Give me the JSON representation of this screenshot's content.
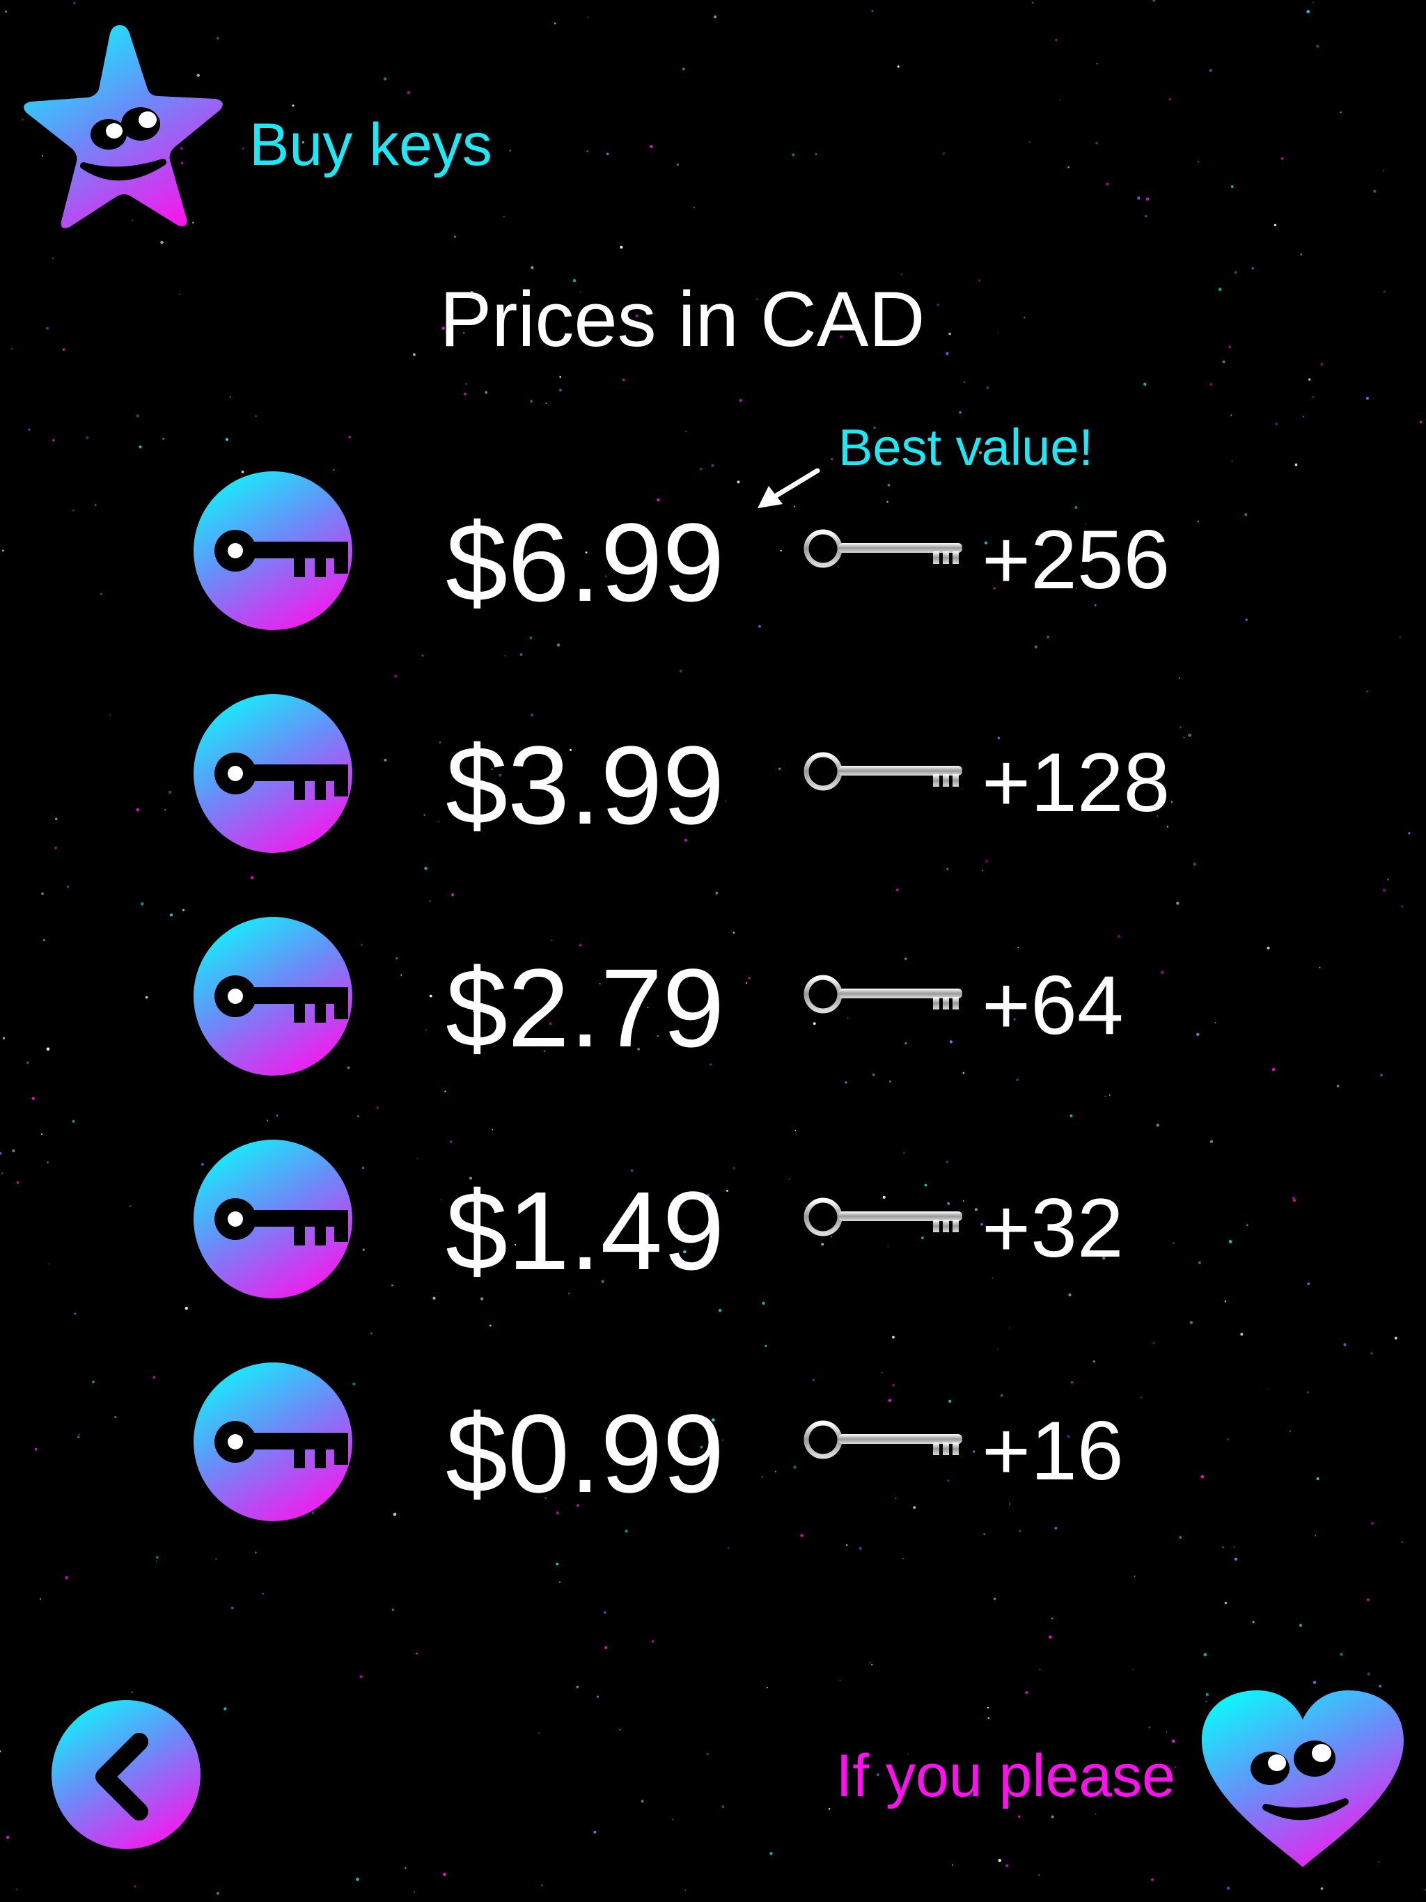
{
  "header": {
    "title": "Buy keys",
    "subtitle": "Prices in CAD"
  },
  "best_value_label": "Best value!",
  "offers": [
    {
      "price": "$6.99",
      "amount": "+256"
    },
    {
      "price": "$3.99",
      "amount": "+128"
    },
    {
      "price": "$2.79",
      "amount": "+64"
    },
    {
      "price": "$1.49",
      "amount": "+32"
    },
    {
      "price": "$0.99",
      "amount": "+16"
    }
  ],
  "footer": {
    "message": "If you please"
  },
  "icons": {
    "logo": "smiling-star-icon",
    "buy": "key-icon",
    "reward": "silver-key-icon",
    "back": "chevron-left-icon",
    "tip": "smiling-heart-icon",
    "best_value_pointer": "arrow-down-left-icon"
  },
  "colors": {
    "background": "#000000",
    "accent_cyan": "#1ee8f5",
    "accent_magenta": "#ff10ee",
    "text": "#ffffff"
  }
}
